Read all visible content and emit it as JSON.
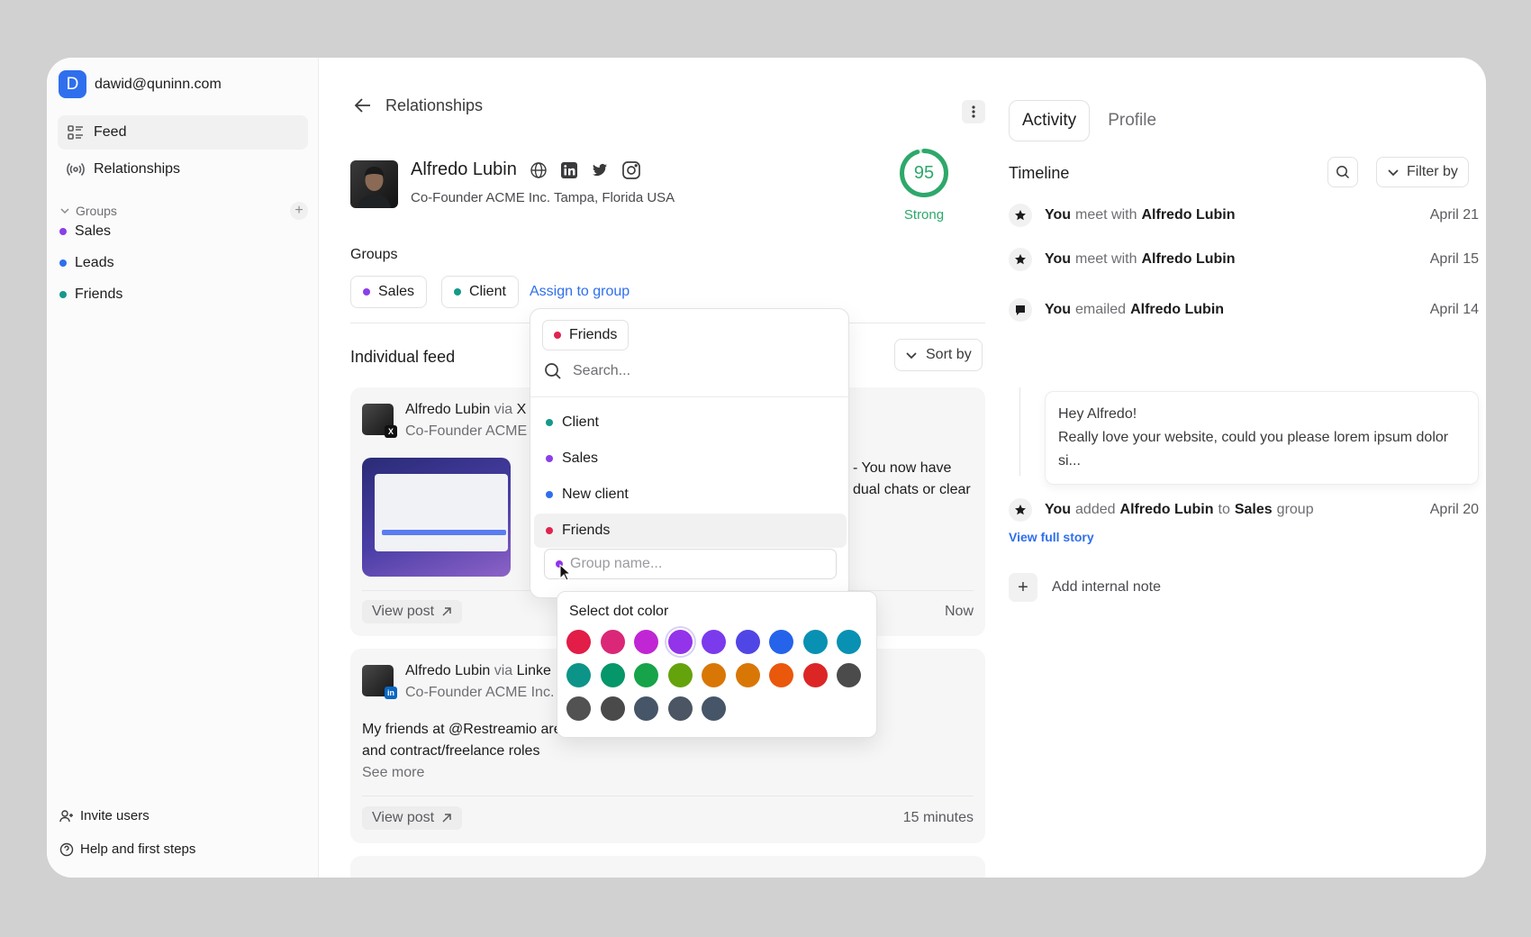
{
  "account": {
    "initial": "D",
    "email": "dawid@quninn.com"
  },
  "nav": [
    {
      "label": "Feed",
      "icon": "list-icon"
    },
    {
      "label": "Relationships",
      "icon": "broadcast-icon"
    }
  ],
  "groups_header": "Groups",
  "sidebar_groups": [
    {
      "label": "Sales",
      "color": "#8b3fe8"
    },
    {
      "label": "Leads",
      "color": "#2f6fed"
    },
    {
      "label": "Friends",
      "color": "#14998a"
    }
  ],
  "footer": {
    "invite": "Invite users",
    "help": "Help and first steps"
  },
  "breadcrumb": "Relationships",
  "contact": {
    "name": "Alfredo Lubin",
    "subtitle": "Co-Founder ACME Inc. Tampa, Florida USA",
    "score": "95",
    "score_label": "Strong",
    "score_fraction": 0.95
  },
  "groups_label": "Groups",
  "assigned_groups": [
    {
      "label": "Sales",
      "color": "#8b3fe8"
    },
    {
      "label": "Client",
      "color": "#14998a"
    }
  ],
  "assign_link": "Assign to group",
  "feed": {
    "title": "Individual feed",
    "sort": "Sort by",
    "post1": {
      "author": "Alfredo Lubin",
      "via": "via",
      "source": "X",
      "subtitle": "Co-Founder ACME",
      "text_right_1": "- You now have",
      "text_right_2": "dual chats or clear",
      "view": "View post",
      "time": "Now"
    },
    "post2": {
      "author": "Alfredo Lubin",
      "via": "via",
      "source": "Linke",
      "subtitle": "Co-Founder ACME Inc.",
      "line1": "My friends at @Restreamio are hiring design engineers for full-time",
      "line2": "and contract/freelance roles",
      "more": "See more",
      "view": "View post",
      "time": "15 minutes"
    }
  },
  "dropdown": {
    "selected": {
      "label": "Friends",
      "color": "#e0244f"
    },
    "search_placeholder": "Search...",
    "options": [
      {
        "label": "Client",
        "color": "#14998a"
      },
      {
        "label": "Sales",
        "color": "#8b3fe8"
      },
      {
        "label": "New client",
        "color": "#2f6fed"
      },
      {
        "label": "Friends",
        "color": "#e0244f"
      }
    ],
    "group_name_placeholder": "Group name..."
  },
  "color_picker": {
    "title": "Select dot color",
    "colors": [
      "#e11d48",
      "#db2777",
      "#c026d3",
      "#9333ea",
      "#7c3aed",
      "#4f46e5",
      "#2563eb",
      "#0891b2",
      "#0891b2",
      "#0d9488",
      "#059669",
      "#16a34a",
      "#65a30d",
      "#d97706",
      "#d97706",
      "#ea580c",
      "#dc2626",
      "#4b4b4b",
      "#525252",
      "#4a4a4a",
      "#475569",
      "#4b5563",
      "#475569"
    ],
    "selected_index": 3
  },
  "right": {
    "tabs": [
      "Activity",
      "Profile"
    ],
    "timeline": "Timeline",
    "filter": "Filter by",
    "events": [
      {
        "actor": "You",
        "verb": "meet with",
        "target": "Alfredo Lubin",
        "date": "April 21",
        "icon": "star-icon"
      },
      {
        "actor": "You",
        "verb": "meet with",
        "target": "Alfredo Lubin",
        "date": "April 15",
        "icon": "star-icon"
      },
      {
        "actor": "You",
        "verb": "emailed",
        "target": "Alfredo Lubin",
        "date": "April 14",
        "icon": "chat-icon"
      },
      {
        "actor": "You",
        "verb": "added",
        "target": "Alfredo Lubin",
        "verb2": "to",
        "target2": "Sales",
        "tail": "group",
        "date": "April 20",
        "icon": "star-icon"
      }
    ],
    "email": {
      "greeting": "Hey Alfredo!",
      "body": "Really love your website, could you please lorem ipsum dolor si..."
    },
    "view_full": "View full story",
    "add_note": "Add internal note"
  }
}
